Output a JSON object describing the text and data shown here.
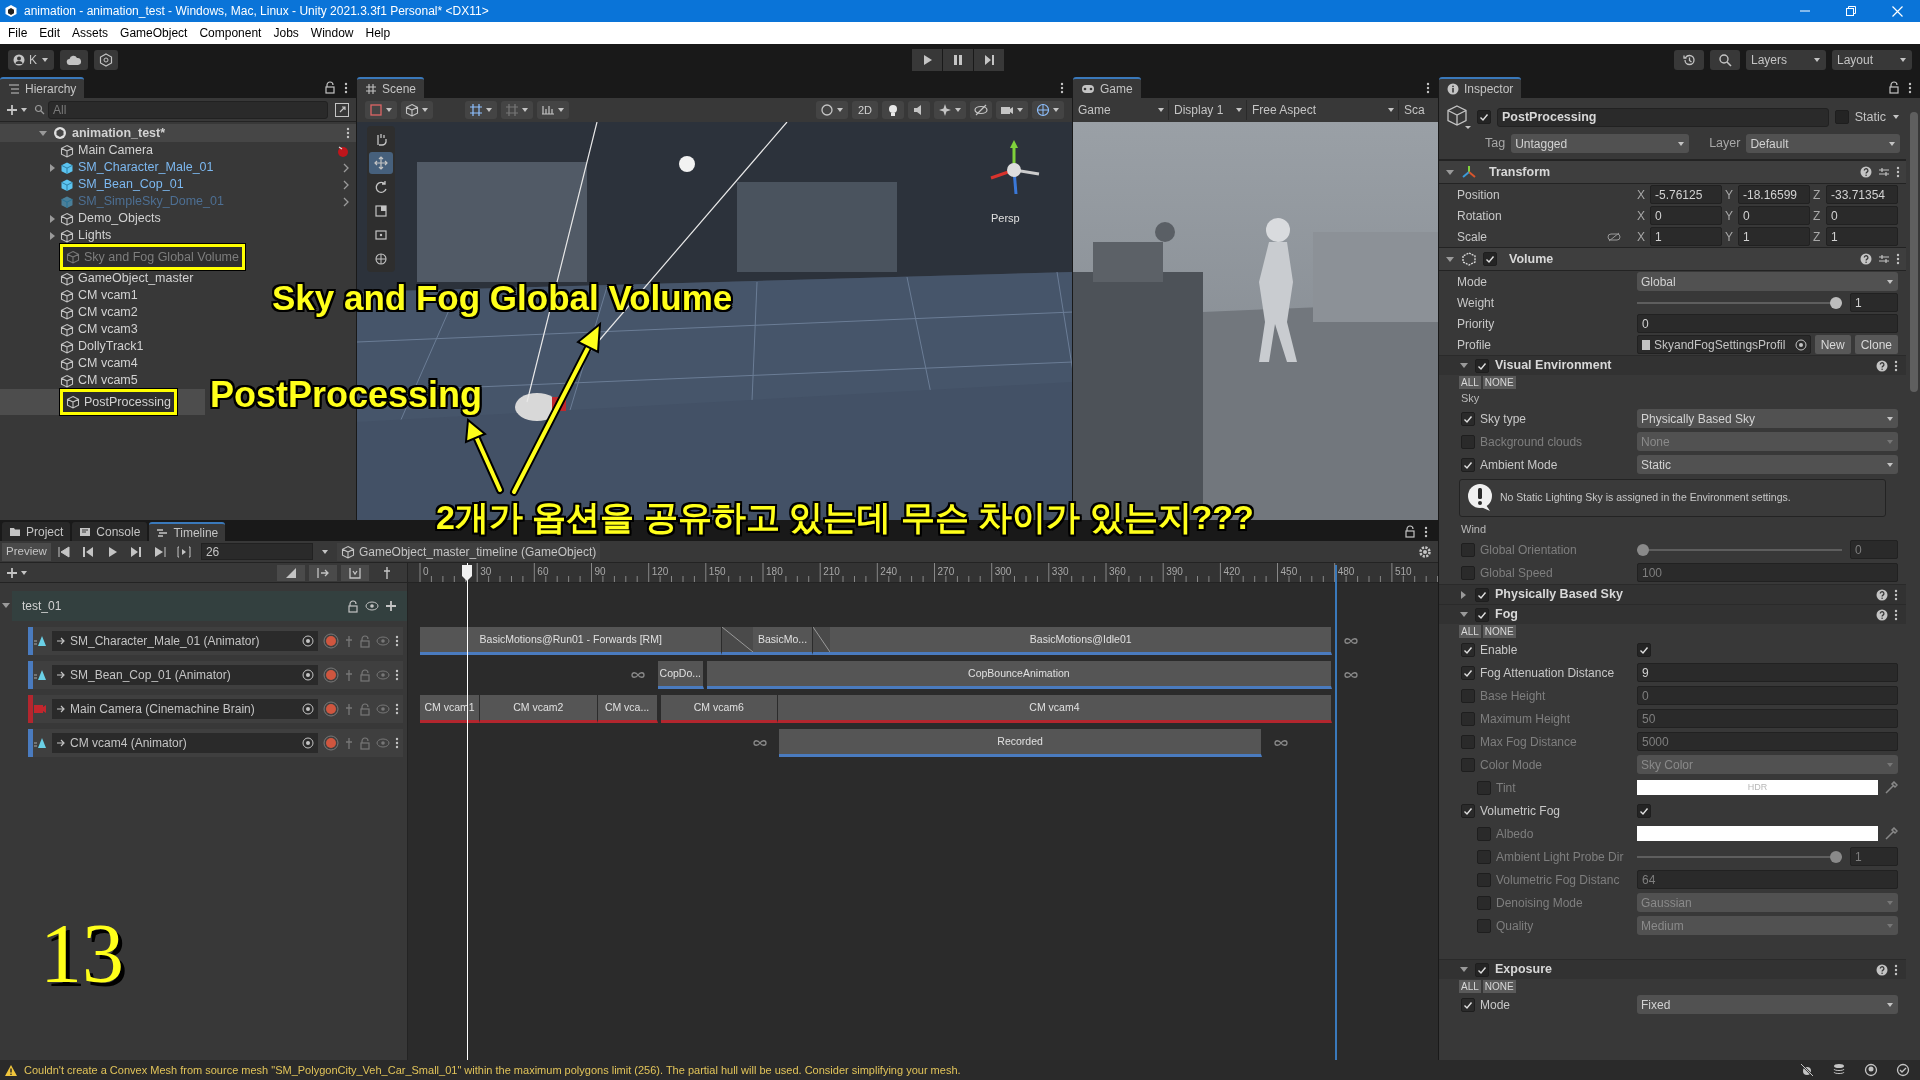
{
  "window": {
    "title": "animation - animation_test - Windows, Mac, Linux - Unity 2021.3.3f1 Personal* <DX11>"
  },
  "menu": [
    "File",
    "Edit",
    "Assets",
    "GameObject",
    "Component",
    "Jobs",
    "Window",
    "Help"
  ],
  "toolbar": {
    "account": "K",
    "layers": "Layers",
    "layout": "Layout"
  },
  "hierarchy": {
    "title": "Hierarchy",
    "search_placeholder": "All",
    "scene": "animation_test*",
    "items": [
      {
        "label": "Main Camera",
        "kind": "camera",
        "active": true,
        "selected": false,
        "annotated": false
      },
      {
        "label": "SM_Character_Male_01",
        "kind": "prefab",
        "active": true,
        "expanded": false,
        "selected": false,
        "annotated": false
      },
      {
        "label": "SM_Bean_Cop_01",
        "kind": "prefab",
        "active": true,
        "selected": false,
        "annotated": false
      },
      {
        "label": "SM_SimpleSky_Dome_01",
        "kind": "prefab",
        "active": false,
        "selected": false,
        "annotated": false
      },
      {
        "label": "Demo_Objects",
        "kind": "object",
        "active": true,
        "expanded": false,
        "selected": false,
        "annotated": false
      },
      {
        "label": "Lights",
        "kind": "object",
        "active": true,
        "expanded": false,
        "selected": false,
        "annotated": false
      },
      {
        "label": "Sky and Fog Global Volume",
        "kind": "object",
        "active": false,
        "selected": false,
        "annotated": true
      },
      {
        "label": "GameObject_master",
        "kind": "object",
        "active": true,
        "selected": false,
        "annotated": false
      },
      {
        "label": "CM vcam1",
        "kind": "object",
        "active": true,
        "selected": false,
        "annotated": false
      },
      {
        "label": "CM vcam2",
        "kind": "object",
        "active": true,
        "selected": false,
        "annotated": false
      },
      {
        "label": "CM vcam3",
        "kind": "object",
        "active": true,
        "selected": false,
        "annotated": false
      },
      {
        "label": "DollyTrack1",
        "kind": "object",
        "active": true,
        "selected": false,
        "annotated": false
      },
      {
        "label": "CM vcam4",
        "kind": "object",
        "active": true,
        "selected": false,
        "annotated": false
      },
      {
        "label": "CM vcam5",
        "kind": "object",
        "active": true,
        "selected": false,
        "annotated": false
      },
      {
        "label": "PostProcessing",
        "kind": "object",
        "active": true,
        "selected": true,
        "annotated": true
      }
    ]
  },
  "scene": {
    "title": "Scene",
    "button_2d": "2D",
    "projection": "Persp"
  },
  "game": {
    "title": "Game",
    "view": "Game",
    "display": "Display 1",
    "aspect": "Free Aspect",
    "scale": "Sca"
  },
  "timeline": {
    "tabs": [
      {
        "label": "Project",
        "selected": false
      },
      {
        "label": "Console",
        "selected": false
      },
      {
        "label": "Timeline",
        "selected": true
      }
    ],
    "preview": "Preview",
    "frame": "26",
    "breadcrumb": "GameObject_master_timeline (GameObject)",
    "ruler": [
      "0",
      "30",
      "60",
      "90",
      "120",
      "150",
      "180",
      "210",
      "240",
      "270",
      "300",
      "330",
      "360",
      "390",
      "420",
      "450",
      "480",
      "510"
    ],
    "group": "test_01",
    "tracks": [
      {
        "name": "SM_Character_Male_01 (Animator)",
        "kind": "animation",
        "color": "#4a7bbf",
        "clips": [
          {
            "kind": "clip",
            "label": "BasicMotions@Run01 - Forwards [RM]"
          },
          {
            "kind": "blend"
          },
          {
            "kind": "clip",
            "label": "BasicMo..."
          },
          {
            "kind": "blend"
          },
          {
            "kind": "clip",
            "label": "BasicMotions@Idle01"
          }
        ]
      },
      {
        "name": "SM_Bean_Cop_01 (Animator)",
        "kind": "animation",
        "color": "#4a7bbf",
        "clips": [
          {
            "kind": "clip",
            "label": "CopDo..."
          },
          {
            "kind": "clip",
            "label": "CopBounceAnimation"
          }
        ]
      },
      {
        "name": "Main Camera (Cinemachine Brain)",
        "kind": "cinemachine",
        "color": "#b3262e",
        "clips": [
          {
            "kind": "clip",
            "label": "CM vcam1"
          },
          {
            "kind": "clip",
            "label": "CM vcam2"
          },
          {
            "kind": "clip",
            "label": "CM vca..."
          },
          {
            "kind": "clip",
            "label": "CM vcam6"
          },
          {
            "kind": "clip",
            "label": "CM vcam4"
          }
        ]
      },
      {
        "name": "CM vcam4 (Animator)",
        "kind": "animation",
        "color": "#4a7bbf",
        "clips": [
          {
            "kind": "clip",
            "label": "Recorded"
          }
        ]
      }
    ]
  },
  "inspector": {
    "title": "Inspector",
    "object": {
      "name": "PostProcessing",
      "active": true,
      "static_label": "Static",
      "static": false,
      "tag_label": "Tag",
      "tag": "Untagged",
      "layer_label": "Layer",
      "layer": "Default"
    },
    "rows": [
      {
        "kind": "component",
        "title": "Transform",
        "expanded": true
      },
      {
        "kind": "vector3",
        "label": "Position",
        "values": [
          {
            "axis": "X",
            "value": "-5.76125"
          },
          {
            "axis": "Y",
            "value": "-18.16599"
          },
          {
            "axis": "Z",
            "value": "-33.71354"
          }
        ]
      },
      {
        "kind": "vector3",
        "label": "Rotation",
        "values": [
          {
            "axis": "X",
            "value": "0"
          },
          {
            "axis": "Y",
            "value": "0"
          },
          {
            "axis": "Z",
            "value": "0"
          }
        ]
      },
      {
        "kind": "vector3",
        "label": "Scale",
        "linked": false,
        "values": [
          {
            "axis": "X",
            "value": "1"
          },
          {
            "axis": "Y",
            "value": "1"
          },
          {
            "axis": "Z",
            "value": "1"
          }
        ]
      },
      {
        "kind": "component",
        "title": "Volume",
        "enabled": true,
        "expanded": true
      },
      {
        "kind": "dropdown",
        "label": "Mode",
        "value": "Global"
      },
      {
        "kind": "slider",
        "label": "Weight",
        "level": 1,
        "value": "1"
      },
      {
        "kind": "number",
        "label": "Priority",
        "value": "0"
      },
      {
        "kind": "object",
        "label": "Profile",
        "value": "SkyandFogSettingsProfil",
        "buttons": [
          "New",
          "Clone"
        ]
      },
      {
        "kind": "section",
        "title": "Visual Environment",
        "enabled": true,
        "expanded": true,
        "all": "ALL",
        "none": "NONE"
      },
      {
        "kind": "heading",
        "text": "Sky"
      },
      {
        "kind": "dropdown",
        "label": "Sky type",
        "value": "Physically Based Sky",
        "override": true
      },
      {
        "kind": "dropdown",
        "label": "Background clouds",
        "value": "None",
        "override": false
      },
      {
        "kind": "dropdown",
        "label": "Ambient Mode",
        "value": "Static",
        "override": true
      },
      {
        "kind": "helpbox",
        "text": "No Static Lighting Sky is assigned in the Environment settings."
      },
      {
        "kind": "heading",
        "text": "Wind"
      },
      {
        "kind": "slider",
        "label": "Global Orientation",
        "level": 0,
        "value": "0",
        "override": false
      },
      {
        "kind": "number",
        "label": "Global Speed",
        "value": "100",
        "override": false
      },
      {
        "kind": "section",
        "title": "Physically Based Sky",
        "enabled": true,
        "expanded": false
      },
      {
        "kind": "section",
        "title": "Fog",
        "enabled": true,
        "expanded": true,
        "all": "ALL",
        "none": "NONE"
      },
      {
        "kind": "check",
        "label": "Enable",
        "checked": true,
        "override": true
      },
      {
        "kind": "number",
        "label": "Fog Attenuation Distance",
        "value": "9",
        "override": true
      },
      {
        "kind": "number",
        "label": "Base Height",
        "value": "0",
        "override": false
      },
      {
        "kind": "number",
        "label": "Maximum Height",
        "value": "50",
        "override": false
      },
      {
        "kind": "number",
        "label": "Max Fog Distance",
        "value": "5000",
        "override": false
      },
      {
        "kind": "dropdown",
        "label": "Color Mode",
        "value": "Sky Color",
        "override": false,
        "children": [
          {
            "kind": "color",
            "label": "Tint",
            "color": "#ffffff",
            "hdr": "HDR",
            "override": false
          }
        ]
      },
      {
        "kind": "check",
        "label": "Volumetric Fog",
        "checked": true,
        "override": true,
        "children": [
          {
            "kind": "color",
            "label": "Albedo",
            "color": "#ffffff",
            "override": false
          },
          {
            "kind": "slider",
            "label": "Ambient Light Probe Dir",
            "level": 1,
            "value": "1",
            "override": false
          },
          {
            "kind": "number",
            "label": "Volumetric Fog Distanc",
            "value": "64",
            "override": false
          },
          {
            "kind": "dropdown",
            "label": "Denoising Mode",
            "value": "Gaussian",
            "override": false
          },
          {
            "kind": "dropdown",
            "label": "Quality",
            "value": "Medium",
            "override": false
          }
        ]
      },
      {
        "kind": "gap"
      },
      {
        "kind": "section",
        "title": "Exposure",
        "enabled": true,
        "expanded": true,
        "all": "ALL",
        "none": "NONE"
      },
      {
        "kind": "dropdown",
        "label": "Mode",
        "value": "Fixed",
        "override": true
      }
    ]
  },
  "status": {
    "message": "Couldn't create a Convex Mesh from source mesh \"SM_PolygonCity_Veh_Car_Small_01\" within the maximum polygons limit (256). The partial hull will be used. Consider simplifying your mesh."
  },
  "annotations": {
    "volume_note": "Sky and Fog Global Volume",
    "post_note": "PostProcessing",
    "question": "2개가 옵션을 공유하고 있는데 무슨 차이가 있는지???",
    "step": "13"
  }
}
